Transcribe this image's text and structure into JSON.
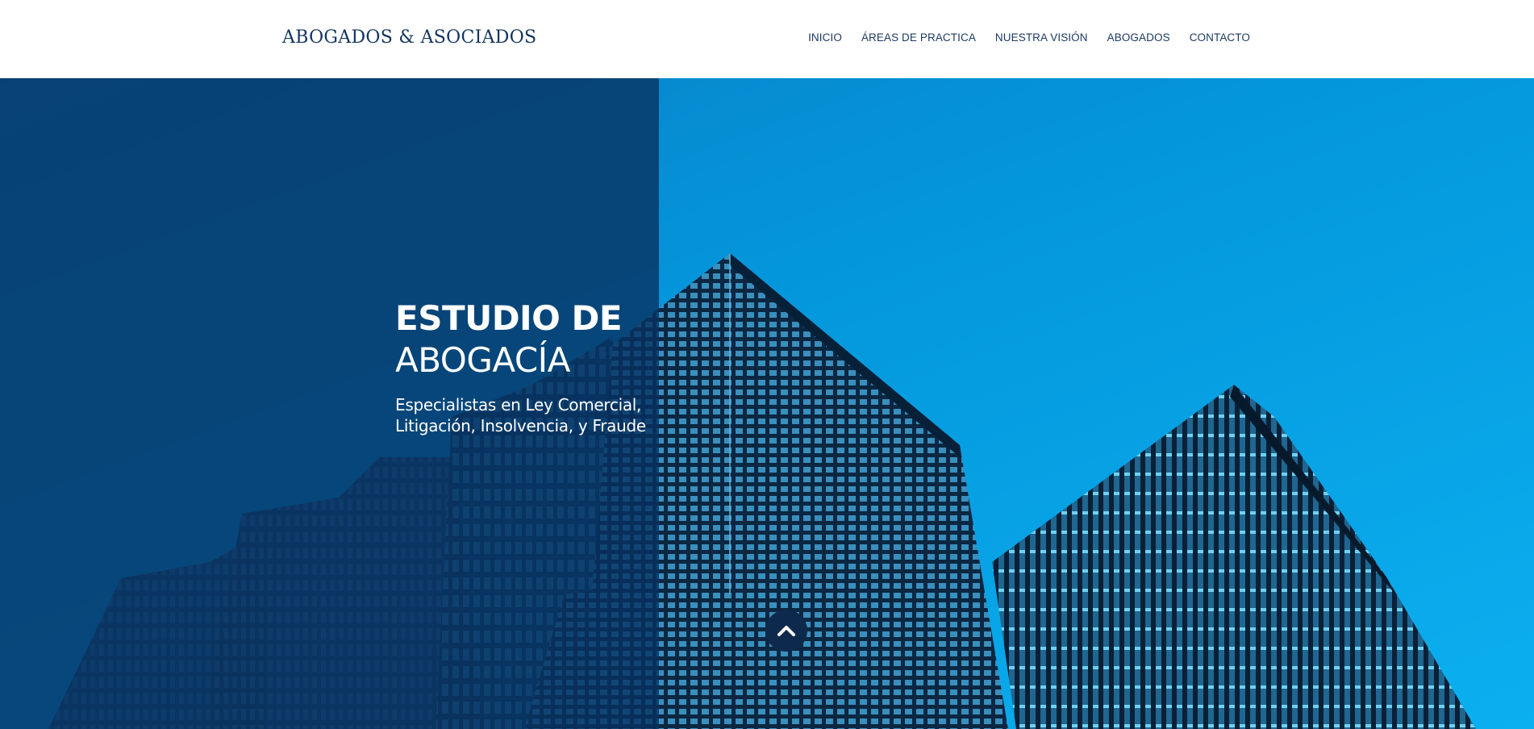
{
  "header": {
    "logo": "ABOGADOS & ASOCIADOS",
    "nav": [
      {
        "label": "INICIO"
      },
      {
        "label": "ÁREAS DE PRACTICA"
      },
      {
        "label": "NUESTRA VISIÓN"
      },
      {
        "label": "ABOGADOS"
      },
      {
        "label": "CONTACTO"
      }
    ]
  },
  "hero": {
    "title_line1": "ESTUDIO DE",
    "title_line2": "ABOGACÍA",
    "subtitle_line1": "Especialistas en Ley Comercial,",
    "subtitle_line2": "Litigación, Insolvencia, y Fraude",
    "background_image": "skyscrapers-photo"
  },
  "scroll_top": {
    "icon": "chevron-up-icon"
  },
  "colors": {
    "brand_navy": "#12345f",
    "overlay": "#083262",
    "sky": "#0496db",
    "button": "#0d2a4d",
    "white": "#ffffff"
  }
}
